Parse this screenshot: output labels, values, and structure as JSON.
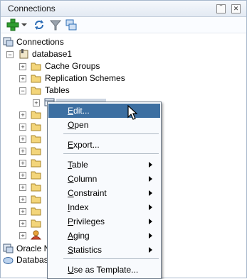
{
  "panel": {
    "title": "Connections"
  },
  "tree": {
    "root": "Connections",
    "database": "database1",
    "items": [
      "Cache Groups",
      "Replication Schemes",
      "Tables"
    ],
    "bottom": [
      "Oracle No",
      "Databas"
    ]
  },
  "menu": {
    "items": [
      {
        "mn": "E",
        "rest": "dit...",
        "submenu": false,
        "selected": true
      },
      {
        "mn": "O",
        "rest": "pen",
        "submenu": false
      },
      {
        "mn": "E",
        "rest": "xport...",
        "submenu": false
      },
      {
        "mn": "T",
        "rest": "able",
        "submenu": true
      },
      {
        "mn": "C",
        "rest": "olumn",
        "submenu": true
      },
      {
        "mn": "C",
        "rest": "onstraint",
        "submenu": true
      },
      {
        "mn": "I",
        "rest": "ndex",
        "submenu": true
      },
      {
        "mn": "P",
        "rest": "rivileges",
        "submenu": true
      },
      {
        "mn": "A",
        "rest": "ging",
        "submenu": true
      },
      {
        "mn": "S",
        "rest": "tatistics",
        "submenu": true
      },
      {
        "mn": "U",
        "rest": "se as Template...",
        "submenu": false
      }
    ]
  },
  "icons": [
    "add-icon",
    "refresh-icon",
    "filter-icon",
    "schema-browser-icon",
    "minimize-icon",
    "close-icon"
  ]
}
